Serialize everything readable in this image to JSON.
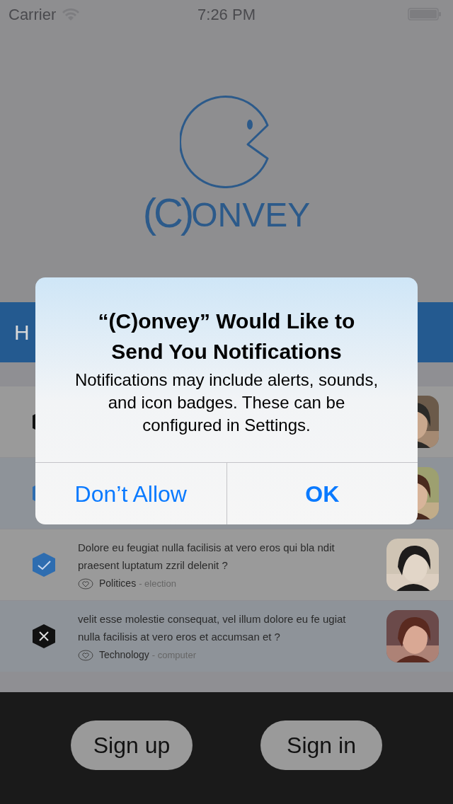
{
  "status_bar": {
    "carrier": "Carrier",
    "time": "7:26 PM"
  },
  "logo": {
    "wordmark_initial": "(C)",
    "wordmark_rest": "ONVEY"
  },
  "header_bar": {
    "label": "H"
  },
  "rows": [
    {
      "kind": "cross"
    },
    {
      "kind": "check"
    },
    {
      "kind": "check",
      "question": "Dolore eu feugiat nulla facilisis at vero eros qui bla ndit praesent luptatum zzril delenit ?",
      "category": "Politices",
      "subcategory": "- election"
    },
    {
      "kind": "cross",
      "question": "velit esse molestie consequat, vel illum dolore eu fe ugiat nulla facilisis at vero eros et accumsan et ?",
      "category": "Technology",
      "subcategory": "- computer"
    }
  ],
  "buttons": [
    "Sign up",
    "Sign in"
  ],
  "alert": {
    "title": "“(C)onvey” Would Like to Send You Notifications",
    "message": "Notifications may include alerts, sounds, and icon badges. These can be configured in Settings.",
    "actions": [
      {
        "label": "Don’t Allow",
        "kind": "cancel"
      },
      {
        "label": "OK",
        "kind": "default"
      }
    ]
  }
}
